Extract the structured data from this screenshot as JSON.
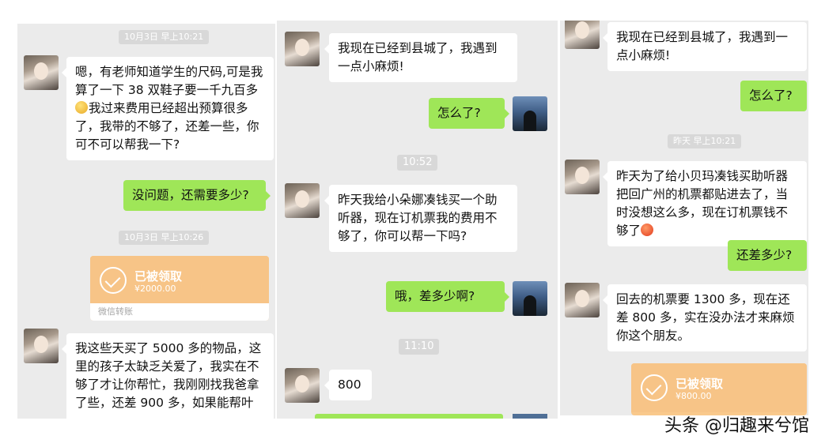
{
  "panel1": {
    "ts1": "10月3日 早上10:21",
    "msg1_a": "嗯，有老师知道学生的尺码,可是我算了一下 38 双鞋子要一千九百多",
    "msg1_b": "我过来费用已经超出预算很多了，我带的不够了，还差一些，你可不可以帮我一下?",
    "reply1": "没问题，还需要多少?",
    "ts2": "10月3日 早上10:26",
    "transfer": {
      "title": "已被领取",
      "amount": "¥2000.00",
      "footer": "微信转账"
    },
    "msg2": "我这些天买了 5000 多的物品，这里的孩子太缺乏关爱了，我实在不够了才让你帮忙，我刚刚找我爸拿了些，还差 900 多，如果能帮叶"
  },
  "panel2": {
    "msg1": "我现在已经到县城了，我遇到一点小麻烦!",
    "reply1": "怎么了?",
    "ts1": "10:52",
    "msg2": "昨天我给小朵娜凑钱买一个助听器，现在订机票我的费用不够了，你可以帮一下吗?",
    "reply2": "哦，差多少啊?",
    "ts2": "11:10",
    "msg3": "800"
  },
  "panel3": {
    "msg1": "我现在已经到县城了，我遇到一点小麻烦!",
    "reply1": "怎么了?",
    "ts1": "昨天 早上10:21",
    "msg2": "昨天为了给小贝玛凑钱买助听器把回广州的机票都贴进去了，当时没想这么多，现在订机票钱不够了",
    "reply2": "还差多少?",
    "msg3": "回去的机票要 1300 多，现在还差 800 多，实在没办法才来麻烦你这个朋友。",
    "transfer": {
      "title": "已被领取",
      "amount": "¥800.00"
    }
  },
  "watermark": "头条 @归趣来兮馆",
  "colors": {
    "bg": "#ebebeb",
    "bubble_self": "#9fe658",
    "bubble_other": "#ffffff",
    "transfer": "#f7c487"
  },
  "icons": {
    "avatar_other": "girl-avatar",
    "avatar_self": "landscape-avatar",
    "emoji1": "dizzy-face-emoji",
    "emoji2": "angry-face-emoji",
    "transfer_icon": "check-circle-icon"
  }
}
